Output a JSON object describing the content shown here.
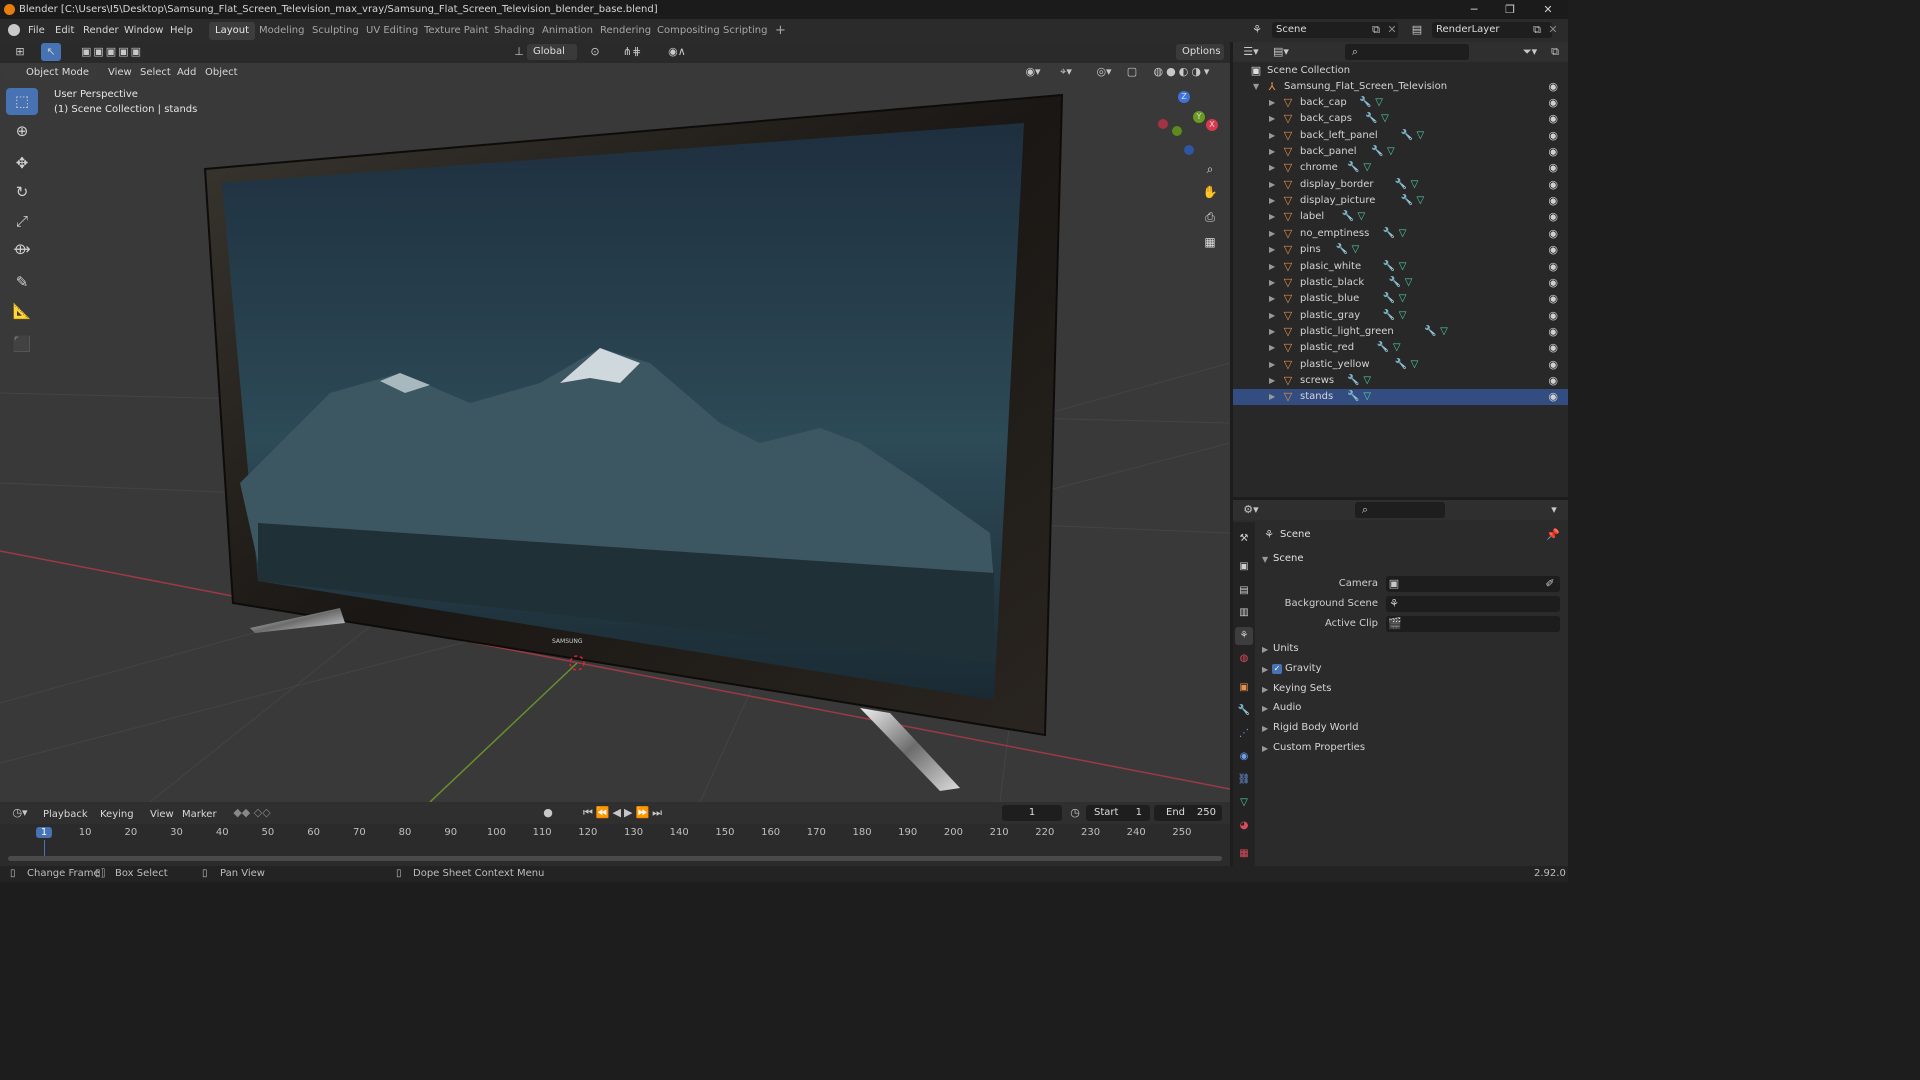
{
  "window": {
    "title": "Blender [C:\\Users\\I5\\Desktop\\Samsung_Flat_Screen_Television_max_vray/Samsung_Flat_Screen_Television_blender_base.blend]",
    "minimize": "─",
    "maximize": "❐",
    "close": "✕"
  },
  "menu": [
    "File",
    "Edit",
    "Render",
    "Window",
    "Help"
  ],
  "workspaces": [
    "Layout",
    "Modeling",
    "Sculpting",
    "UV Editing",
    "Texture Paint",
    "Shading",
    "Animation",
    "Rendering",
    "Compositing",
    "Scripting"
  ],
  "scene": {
    "name": "Scene",
    "view_layer": "RenderLayer"
  },
  "viewport_header": {
    "mode": "Object Mode",
    "menus": [
      "View",
      "Select",
      "Add",
      "Object"
    ],
    "orientation": "Global",
    "options": "Options"
  },
  "viewport": {
    "perspective": "User Perspective",
    "collection_info": "(1) Scene Collection | stands",
    "gizmo": {
      "x": "X",
      "y": "Y",
      "z": "Z"
    },
    "tv_brand": "SAMSUNG"
  },
  "outliner": {
    "root": "Scene Collection",
    "collection": "Samsung_Flat_Screen_Television",
    "items": [
      "back_cap",
      "back_caps",
      "back_left_panel",
      "back_panel",
      "chrome",
      "display_border",
      "display_picture",
      "label",
      "no_emptiness",
      "pins",
      "plasic_white",
      "plastic_black",
      "plastic_blue",
      "plastic_gray",
      "plastic_light_green",
      "plastic_red",
      "plastic_yellow",
      "screws",
      "stands"
    ]
  },
  "properties": {
    "context": "Scene",
    "panel": "Scene",
    "fields": [
      {
        "label": "Camera"
      },
      {
        "label": "Background Scene"
      },
      {
        "label": "Active Clip"
      }
    ],
    "sections": [
      "Units",
      "Gravity",
      "Keying Sets",
      "Audio",
      "Rigid Body World",
      "Custom Properties"
    ],
    "gravity_checked": true
  },
  "timeline": {
    "menus": [
      "Playback",
      "Keying",
      "View",
      "Marker"
    ],
    "current_frame": "1",
    "start_label": "Start",
    "start": "1",
    "end_label": "End",
    "end": "250",
    "ticks": [
      "1",
      "10",
      "20",
      "30",
      "40",
      "50",
      "60",
      "70",
      "80",
      "90",
      "100",
      "110",
      "120",
      "130",
      "140",
      "150",
      "160",
      "170",
      "180",
      "190",
      "200",
      "210",
      "220",
      "230",
      "240",
      "250"
    ]
  },
  "statusbar": {
    "items": [
      "Change Frame",
      "Box Select",
      "Pan View",
      "Dope Sheet Context Menu"
    ],
    "version": "2.92.0"
  },
  "colors": {
    "accent": "#4772b3",
    "selection": "#334d80",
    "object": "#e8914a",
    "mesh": "#52d0a8",
    "modifier": "#6ea0f0"
  }
}
